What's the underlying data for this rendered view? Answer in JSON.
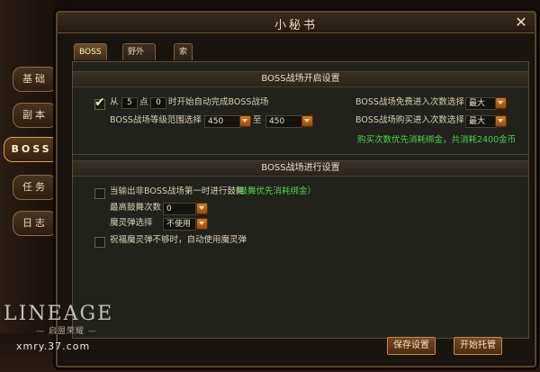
{
  "window": {
    "title": "小秘书"
  },
  "tabs": [
    {
      "label": "BOSS战场"
    },
    {
      "label": "野外BOSS"
    },
    {
      "label": "索瞳试炼"
    }
  ],
  "sidenav": [
    {
      "label": "基础"
    },
    {
      "label": "副本"
    },
    {
      "label": "BOSS"
    },
    {
      "label": "任务"
    },
    {
      "label": "日志"
    }
  ],
  "section1": {
    "header": "BOSS战场开启设置",
    "auto": {
      "prefix": "从",
      "hour": "5",
      "mid": "点",
      "minute": "0",
      "suffix": "时开始自动完成BOSS战场",
      "checked": true
    },
    "level_range": {
      "label": "BOSS战场等级范围选择",
      "min": "450",
      "to": "至",
      "max": "450"
    },
    "free_entry": {
      "label": "BOSS战场免费进入次数选择",
      "value": "最大"
    },
    "buy_entry": {
      "label": "BOSS战场购买进入次数选择",
      "value": "最大"
    },
    "note": "购买次数优先消耗绑金，共消耗2400金币"
  },
  "section2": {
    "header": "BOSS战场进行设置",
    "boss_dance": {
      "label": "当输出非BOSS战场第一时进行鼓舞",
      "note": "（鼓舞优先消耗绑金）",
      "checked": false
    },
    "max_dance": {
      "label": "最高鼓舞次数",
      "value": "0"
    },
    "spirit_ball": {
      "label": "魔灵弹选择",
      "value": "不使用"
    },
    "bless": {
      "label": "祝福魔灵弹不够时，自动使用魔灵弹",
      "checked": false
    }
  },
  "buttons": {
    "save": "保存设置",
    "start": "开始托管"
  },
  "branding": {
    "logo": "LINEAGE",
    "sub": "— 启盟荣耀 —",
    "watermark": "xmry.37.com"
  }
}
